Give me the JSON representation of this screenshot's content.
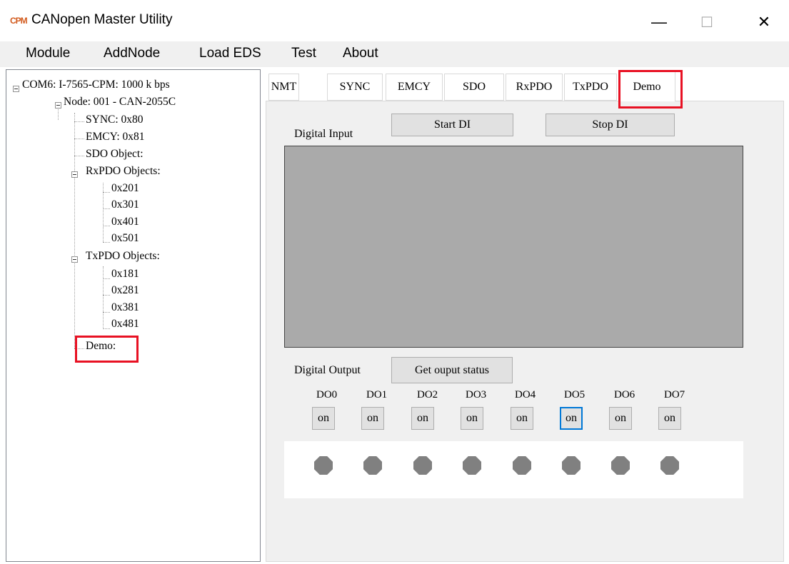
{
  "window": {
    "icon_text": "CPM",
    "title": "CANopen Master Utility",
    "controls": {
      "minimize": "—",
      "maximize": "☐",
      "close": "✕"
    }
  },
  "menu": [
    "Module",
    "AddNode",
    "Load EDS",
    "Test",
    "About"
  ],
  "tree": {
    "root": "COM6: I-7565-CPM: 1000 k bps",
    "node": "Node: 001 - CAN-2055C",
    "sync": "SYNC: 0x80",
    "emcy": "EMCY: 0x81",
    "sdo": "SDO Object:",
    "rxpdo": {
      "label": "RxPDO Objects:",
      "items": [
        "0x201",
        "0x301",
        "0x401",
        "0x501"
      ]
    },
    "txpdo": {
      "label": "TxPDO Objects:",
      "items": [
        "0x181",
        "0x281",
        "0x381",
        "0x481"
      ]
    },
    "demo": "Demo:"
  },
  "tabs": [
    "NMT",
    "SYNC",
    "EMCY",
    "SDO",
    "RxPDO",
    "TxPDO",
    "Demo"
  ],
  "active_tab": "Demo",
  "demo": {
    "digital_input_label": "Digital Input",
    "start_di": "Start DI",
    "stop_di": "Stop DI",
    "digital_output_label": "Digital Output",
    "get_output_status": "Get ouput status",
    "outputs": [
      {
        "label": "DO0",
        "button": "on"
      },
      {
        "label": "DO1",
        "button": "on"
      },
      {
        "label": "DO2",
        "button": "on"
      },
      {
        "label": "DO3",
        "button": "on"
      },
      {
        "label": "DO4",
        "button": "on"
      },
      {
        "label": "DO5",
        "button": "on"
      },
      {
        "label": "DO6",
        "button": "on"
      },
      {
        "label": "DO7",
        "button": "on"
      }
    ],
    "focused_output": "DO5"
  },
  "colors": {
    "highlight": "#e81123",
    "focus": "#0078d7",
    "led_off": "#808080",
    "di_display": "#aaaaaa"
  }
}
